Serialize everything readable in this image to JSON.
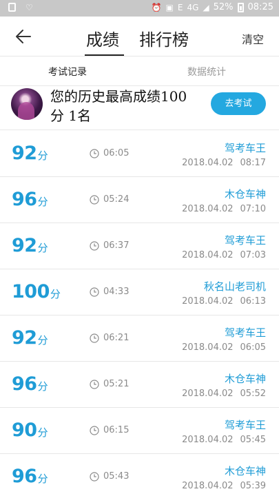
{
  "status_bar": {
    "battery": "52%",
    "time": "08:25",
    "network": "4G",
    "signal_e": "E"
  },
  "header": {
    "tabs": [
      "成绩",
      "排行榜"
    ],
    "clear_label": "清空"
  },
  "subtabs": [
    "考试记录",
    "数据统计"
  ],
  "best": {
    "line1": "您的历史最高成绩100",
    "line2": "分  1名",
    "button_label": "去考试"
  },
  "records": [
    {
      "score": "92",
      "unit": "分",
      "duration": "06:05",
      "name": "驾考车王",
      "date": "2018.04.02",
      "time": "08:17"
    },
    {
      "score": "96",
      "unit": "分",
      "duration": "05:24",
      "name": "木仓车神",
      "date": "2018.04.02",
      "time": "07:10"
    },
    {
      "score": "92",
      "unit": "分",
      "duration": "06:37",
      "name": "驾考车王",
      "date": "2018.04.02",
      "time": "07:03"
    },
    {
      "score": "100",
      "unit": "分",
      "duration": "04:33",
      "name": "秋名山老司机",
      "date": "2018.04.02",
      "time": "06:13"
    },
    {
      "score": "92",
      "unit": "分",
      "duration": "06:21",
      "name": "驾考车王",
      "date": "2018.04.02",
      "time": "06:05"
    },
    {
      "score": "96",
      "unit": "分",
      "duration": "05:21",
      "name": "木仓车神",
      "date": "2018.04.02",
      "time": "05:52"
    },
    {
      "score": "90",
      "unit": "分",
      "duration": "06:15",
      "name": "驾考车王",
      "date": "2018.04.02",
      "time": "05:45"
    },
    {
      "score": "96",
      "unit": "分",
      "duration": "05:43",
      "name": "木仓车神",
      "date": "2018.04.02",
      "time": "05:39"
    }
  ],
  "colors": {
    "accent": "#1f9cd6",
    "button": "#24a8e0"
  }
}
